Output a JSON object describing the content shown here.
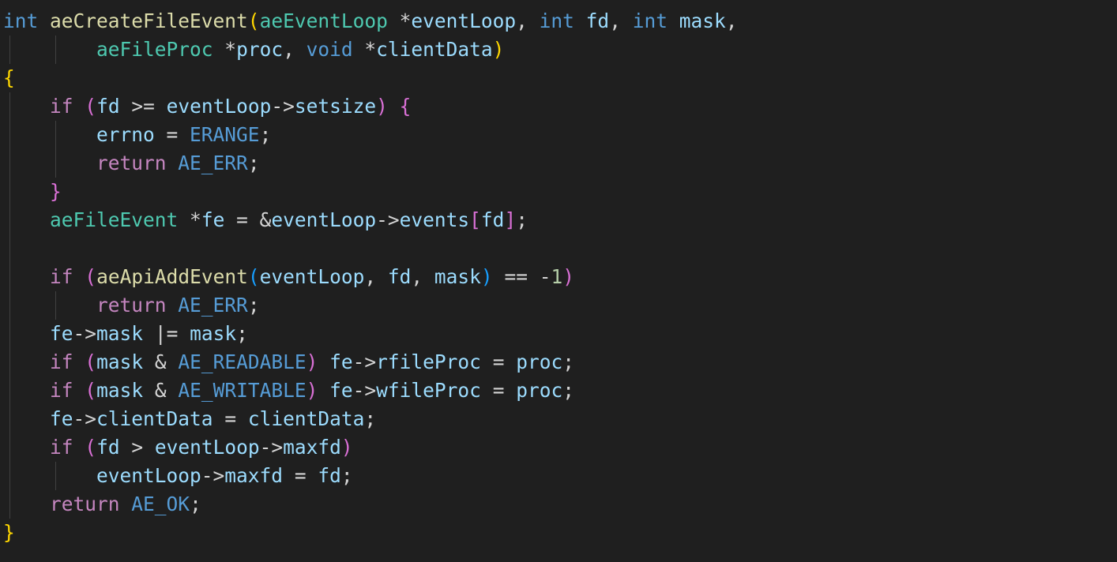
{
  "editor": {
    "language": "C",
    "theme_colors": {
      "background": "#1f1f1f",
      "keyword": "#569cd6",
      "control": "#c586c0",
      "function": "#dcdcaa",
      "type": "#4ec9b0",
      "variable": "#9cdcfe",
      "number": "#b5cea8",
      "bracket_level_1": "#ffd700",
      "bracket_level_2": "#da70d6",
      "bracket_level_3": "#179fff"
    },
    "lines": [
      [
        {
          "t": "int",
          "c": "kw"
        },
        {
          "t": " ",
          "c": "p"
        },
        {
          "t": "aeCreateFileEvent",
          "c": "fn"
        },
        {
          "t": "(",
          "c": "b1"
        },
        {
          "t": "aeEventLoop",
          "c": "ty"
        },
        {
          "t": " ",
          "c": "p"
        },
        {
          "t": "*",
          "c": "p"
        },
        {
          "t": "eventLoop",
          "c": "var"
        },
        {
          "t": ", ",
          "c": "p"
        },
        {
          "t": "int",
          "c": "kw"
        },
        {
          "t": " ",
          "c": "p"
        },
        {
          "t": "fd",
          "c": "var"
        },
        {
          "t": ", ",
          "c": "p"
        },
        {
          "t": "int",
          "c": "kw"
        },
        {
          "t": " ",
          "c": "p"
        },
        {
          "t": "mask",
          "c": "var"
        },
        {
          "t": ",",
          "c": "p"
        }
      ],
      [
        {
          "t": "        ",
          "c": "p"
        },
        {
          "t": "aeFileProc",
          "c": "ty"
        },
        {
          "t": " ",
          "c": "p"
        },
        {
          "t": "*",
          "c": "p"
        },
        {
          "t": "proc",
          "c": "var"
        },
        {
          "t": ", ",
          "c": "p"
        },
        {
          "t": "void",
          "c": "kw"
        },
        {
          "t": " ",
          "c": "p"
        },
        {
          "t": "*",
          "c": "p"
        },
        {
          "t": "clientData",
          "c": "var"
        },
        {
          "t": ")",
          "c": "b1"
        }
      ],
      [
        {
          "t": "{",
          "c": "b1"
        }
      ],
      [
        {
          "t": "    ",
          "c": "p"
        },
        {
          "t": "if",
          "c": "ctl"
        },
        {
          "t": " ",
          "c": "p"
        },
        {
          "t": "(",
          "c": "b2"
        },
        {
          "t": "fd",
          "c": "var"
        },
        {
          "t": " >= ",
          "c": "p"
        },
        {
          "t": "eventLoop",
          "c": "var"
        },
        {
          "t": "->",
          "c": "p"
        },
        {
          "t": "setsize",
          "c": "var"
        },
        {
          "t": ")",
          "c": "b2"
        },
        {
          "t": " ",
          "c": "p"
        },
        {
          "t": "{",
          "c": "b2"
        }
      ],
      [
        {
          "t": "        ",
          "c": "p"
        },
        {
          "t": "errno",
          "c": "var"
        },
        {
          "t": " = ",
          "c": "p"
        },
        {
          "t": "ERANGE",
          "c": "mac"
        },
        {
          "t": ";",
          "c": "p"
        }
      ],
      [
        {
          "t": "        ",
          "c": "p"
        },
        {
          "t": "return",
          "c": "ctl"
        },
        {
          "t": " ",
          "c": "p"
        },
        {
          "t": "AE_ERR",
          "c": "mac"
        },
        {
          "t": ";",
          "c": "p"
        }
      ],
      [
        {
          "t": "    ",
          "c": "p"
        },
        {
          "t": "}",
          "c": "b2"
        }
      ],
      [
        {
          "t": "    ",
          "c": "p"
        },
        {
          "t": "aeFileEvent",
          "c": "ty"
        },
        {
          "t": " ",
          "c": "p"
        },
        {
          "t": "*",
          "c": "p"
        },
        {
          "t": "fe",
          "c": "var"
        },
        {
          "t": " = ",
          "c": "p"
        },
        {
          "t": "&",
          "c": "p"
        },
        {
          "t": "eventLoop",
          "c": "var"
        },
        {
          "t": "->",
          "c": "p"
        },
        {
          "t": "events",
          "c": "var"
        },
        {
          "t": "[",
          "c": "b2"
        },
        {
          "t": "fd",
          "c": "var"
        },
        {
          "t": "]",
          "c": "b2"
        },
        {
          "t": ";",
          "c": "p"
        }
      ],
      [],
      [
        {
          "t": "    ",
          "c": "p"
        },
        {
          "t": "if",
          "c": "ctl"
        },
        {
          "t": " ",
          "c": "p"
        },
        {
          "t": "(",
          "c": "b2"
        },
        {
          "t": "aeApiAddEvent",
          "c": "fn"
        },
        {
          "t": "(",
          "c": "b3"
        },
        {
          "t": "eventLoop",
          "c": "var"
        },
        {
          "t": ", ",
          "c": "p"
        },
        {
          "t": "fd",
          "c": "var"
        },
        {
          "t": ", ",
          "c": "p"
        },
        {
          "t": "mask",
          "c": "var"
        },
        {
          "t": ")",
          "c": "b3"
        },
        {
          "t": " == ",
          "c": "p"
        },
        {
          "t": "-",
          "c": "p"
        },
        {
          "t": "1",
          "c": "num"
        },
        {
          "t": ")",
          "c": "b2"
        }
      ],
      [
        {
          "t": "        ",
          "c": "p"
        },
        {
          "t": "return",
          "c": "ctl"
        },
        {
          "t": " ",
          "c": "p"
        },
        {
          "t": "AE_ERR",
          "c": "mac"
        },
        {
          "t": ";",
          "c": "p"
        }
      ],
      [
        {
          "t": "    ",
          "c": "p"
        },
        {
          "t": "fe",
          "c": "var"
        },
        {
          "t": "->",
          "c": "p"
        },
        {
          "t": "mask",
          "c": "var"
        },
        {
          "t": " |= ",
          "c": "p"
        },
        {
          "t": "mask",
          "c": "var"
        },
        {
          "t": ";",
          "c": "p"
        }
      ],
      [
        {
          "t": "    ",
          "c": "p"
        },
        {
          "t": "if",
          "c": "ctl"
        },
        {
          "t": " ",
          "c": "p"
        },
        {
          "t": "(",
          "c": "b2"
        },
        {
          "t": "mask",
          "c": "var"
        },
        {
          "t": " & ",
          "c": "p"
        },
        {
          "t": "AE_READABLE",
          "c": "mac"
        },
        {
          "t": ")",
          "c": "b2"
        },
        {
          "t": " ",
          "c": "p"
        },
        {
          "t": "fe",
          "c": "var"
        },
        {
          "t": "->",
          "c": "p"
        },
        {
          "t": "rfileProc",
          "c": "var"
        },
        {
          "t": " = ",
          "c": "p"
        },
        {
          "t": "proc",
          "c": "var"
        },
        {
          "t": ";",
          "c": "p"
        }
      ],
      [
        {
          "t": "    ",
          "c": "p"
        },
        {
          "t": "if",
          "c": "ctl"
        },
        {
          "t": " ",
          "c": "p"
        },
        {
          "t": "(",
          "c": "b2"
        },
        {
          "t": "mask",
          "c": "var"
        },
        {
          "t": " & ",
          "c": "p"
        },
        {
          "t": "AE_WRITABLE",
          "c": "mac"
        },
        {
          "t": ")",
          "c": "b2"
        },
        {
          "t": " ",
          "c": "p"
        },
        {
          "t": "fe",
          "c": "var"
        },
        {
          "t": "->",
          "c": "p"
        },
        {
          "t": "wfileProc",
          "c": "var"
        },
        {
          "t": " = ",
          "c": "p"
        },
        {
          "t": "proc",
          "c": "var"
        },
        {
          "t": ";",
          "c": "p"
        }
      ],
      [
        {
          "t": "    ",
          "c": "p"
        },
        {
          "t": "fe",
          "c": "var"
        },
        {
          "t": "->",
          "c": "p"
        },
        {
          "t": "clientData",
          "c": "var"
        },
        {
          "t": " = ",
          "c": "p"
        },
        {
          "t": "clientData",
          "c": "var"
        },
        {
          "t": ";",
          "c": "p"
        }
      ],
      [
        {
          "t": "    ",
          "c": "p"
        },
        {
          "t": "if",
          "c": "ctl"
        },
        {
          "t": " ",
          "c": "p"
        },
        {
          "t": "(",
          "c": "b2"
        },
        {
          "t": "fd",
          "c": "var"
        },
        {
          "t": " > ",
          "c": "p"
        },
        {
          "t": "eventLoop",
          "c": "var"
        },
        {
          "t": "->",
          "c": "p"
        },
        {
          "t": "maxfd",
          "c": "var"
        },
        {
          "t": ")",
          "c": "b2"
        }
      ],
      [
        {
          "t": "        ",
          "c": "p"
        },
        {
          "t": "eventLoop",
          "c": "var"
        },
        {
          "t": "->",
          "c": "p"
        },
        {
          "t": "maxfd",
          "c": "var"
        },
        {
          "t": " = ",
          "c": "p"
        },
        {
          "t": "fd",
          "c": "var"
        },
        {
          "t": ";",
          "c": "p"
        }
      ],
      [
        {
          "t": "    ",
          "c": "p"
        },
        {
          "t": "return",
          "c": "ctl"
        },
        {
          "t": " ",
          "c": "p"
        },
        {
          "t": "AE_OK",
          "c": "mac"
        },
        {
          "t": ";",
          "c": "p"
        }
      ],
      [
        {
          "t": "}",
          "c": "b1"
        }
      ]
    ]
  }
}
